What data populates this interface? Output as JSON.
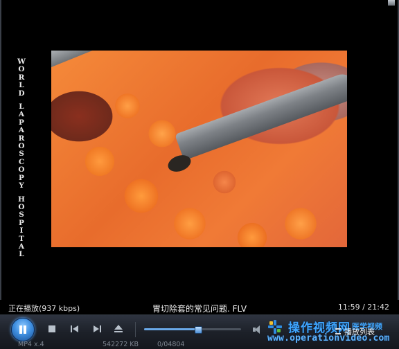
{
  "player": {
    "watermark_lines": [
      "WORLD",
      "LAPAROSCOPY",
      "HOSPITAL"
    ],
    "status": {
      "now_playing": "正在播放(937 kbps)",
      "title": "胃切除套的常见问题. FLV",
      "time": "11:59 / 21:42"
    },
    "controls": {
      "play_pause": "pause",
      "seek_progress": 0.55
    },
    "info": {
      "format": "MP4 x.4",
      "size": "542272 KB",
      "extra": "0/04804"
    },
    "branding": {
      "cn_name": "操作视频网",
      "cn_sub": "医学视频",
      "url": "www.operationvideo.com"
    },
    "playlist_label": "播放列表",
    "colors": {
      "accent": "#3f8fe0",
      "logo": "#3fa6ff"
    }
  }
}
